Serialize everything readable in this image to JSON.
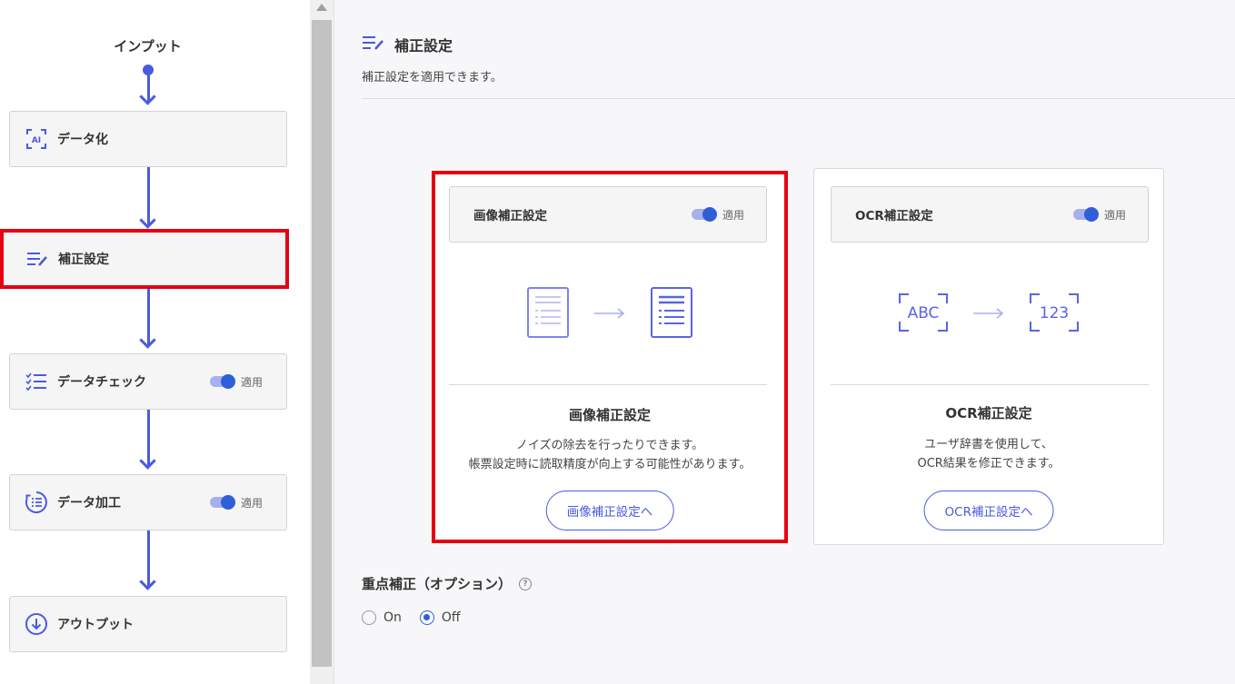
{
  "flow": {
    "input_label": "インプット",
    "steps": [
      {
        "label": "データ化",
        "icon": "ai-scan-icon",
        "toggle": null
      },
      {
        "label": "補正設定",
        "icon": "edit-list-icon",
        "toggle": null,
        "selected": true
      },
      {
        "label": "データチェック",
        "icon": "checklist-icon",
        "toggle": "適用"
      },
      {
        "label": "データ加工",
        "icon": "list-circle-icon",
        "toggle": "適用"
      },
      {
        "label": "アウトプット",
        "icon": "download-circle-icon",
        "toggle": null
      }
    ]
  },
  "main": {
    "title": "補正設定",
    "subtitle": "補正設定を適用できます。",
    "cards": [
      {
        "head_label": "画像補正設定",
        "toggle_label": "適用",
        "title": "画像補正設定",
        "desc_line1": "ノイズの除去を行ったりできます。",
        "desc_line2": "帳票設定時に読取精度が向上する可能性があります。",
        "button": "画像補正設定へ",
        "selected": true
      },
      {
        "head_label": "OCR補正設定",
        "toggle_label": "適用",
        "title": "OCR補正設定",
        "desc_line1": "ユーザ辞書を使用して、",
        "desc_line2": "OCR結果を修正できます。",
        "button": "OCR補正設定へ",
        "illus_from": "ABC",
        "illus_to": "123"
      }
    ],
    "focus": {
      "title": "重点補正（オプション）",
      "help": "?",
      "options": [
        "On",
        "Off"
      ],
      "selected": "Off"
    }
  },
  "colors": {
    "accent": "#4a5ae0",
    "highlight": "#e60012",
    "toggle": "#2f5fd8"
  }
}
